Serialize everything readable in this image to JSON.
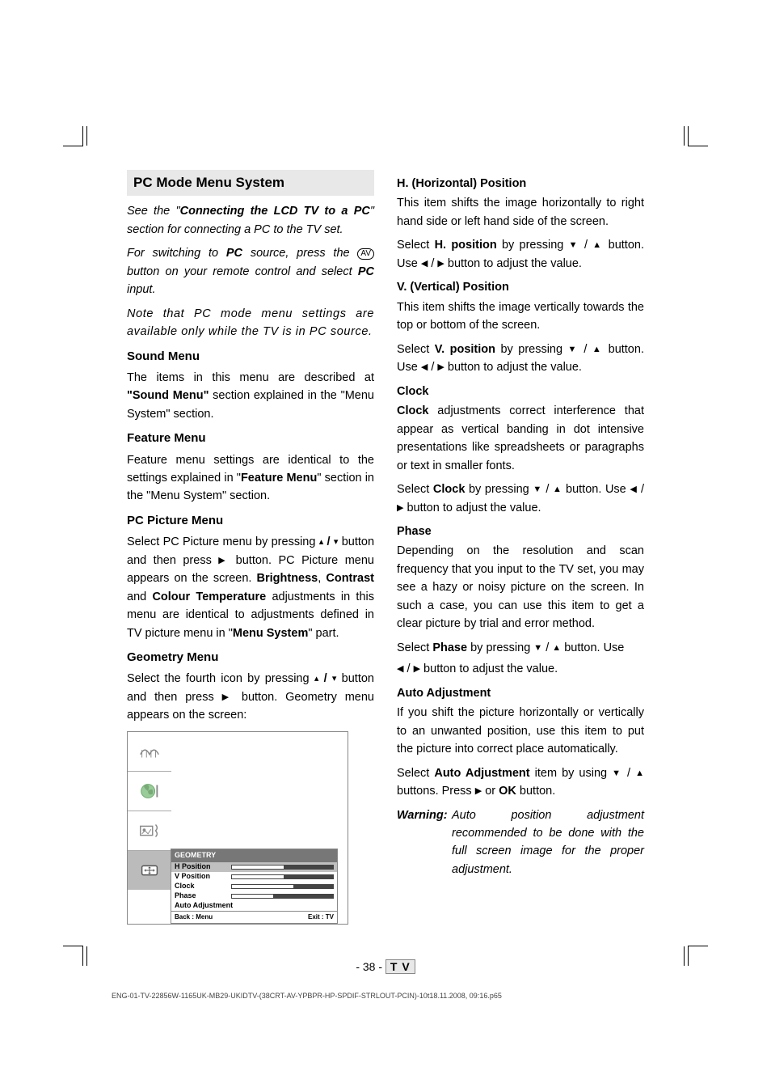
{
  "left": {
    "title": "PC Mode Menu System",
    "intro1_a": "See the \"",
    "intro1_b": "Connecting the LCD TV to a PC",
    "intro1_c": "\" section for connecting a PC to the TV set.",
    "intro2_a": "For switching to ",
    "intro2_b": "PC",
    "intro2_c": " source, press the ",
    "intro2_av": "AV",
    "intro2_d": " button on your remote control and select ",
    "intro2_e": "PC",
    "intro2_f": " input.",
    "intro3": "Note that PC mode menu settings are available only while the TV is in PC source.",
    "sound_h": "Sound Menu",
    "sound_p_a": "The items in this menu are described at ",
    "sound_p_b": "\"Sound Menu\"",
    "sound_p_c": " section explained in the \"Menu System\" section.",
    "feature_h": "Feature Menu",
    "feature_p_a": "Feature menu settings are identical to the settings explained in \"",
    "feature_p_b": "Feature Menu",
    "feature_p_c": "\" section in the \"Menu System\" section.",
    "pcpic_h": "PC Picture Menu",
    "pcpic_a": "Select PC Picture menu by pressing ",
    "pcpic_b": " / ",
    "pcpic_c": " button and then press ",
    "pcpic_d": " button. PC Picture menu appears on the screen. ",
    "pcpic_e": "Brightness",
    "pcpic_f": ", ",
    "pcpic_g": "Contrast",
    "pcpic_h2": " and ",
    "pcpic_i": "Colour Temperature",
    "pcpic_j": " adjustments in this menu are identical to adjustments defined in TV picture menu in \"",
    "pcpic_k": "Menu System",
    "pcpic_l": "\" part.",
    "geom_h": "Geometry Menu",
    "geom_a": "Select the fourth icon by pressing ",
    "geom_b": " / ",
    "geom_c": "  button and then press ",
    "geom_d": " button. Geometry menu appears on the screen:"
  },
  "ui": {
    "title": "GEOMETRY",
    "rows": [
      {
        "label": "H Position",
        "fill": 50
      },
      {
        "label": "V Position",
        "fill": 50
      },
      {
        "label": "Clock",
        "fill": 60
      },
      {
        "label": "Phase",
        "fill": 40
      },
      {
        "label": "Auto Adjustment",
        "fill": null
      }
    ],
    "foot_left": "Back : Menu",
    "foot_right": "Exit : TV"
  },
  "right": {
    "hpos_h": "H. (Horizontal) Position",
    "hpos_p": "This item shifts the image horizontally to right hand side or left hand side of the screen.",
    "hpos_sel_a": "Select ",
    "hpos_sel_b": "H. position",
    "hpos_sel_c": " by pressing ",
    "hpos_sel_d": " button. Use ",
    "hpos_sel_e": " button to adjust the value.",
    "vpos_h": "V. (Vertical) Position",
    "vpos_p": "This item shifts the image vertically towards the top or bottom of the screen.",
    "vpos_sel_a": "Select ",
    "vpos_sel_b": "V. position",
    "vpos_sel_c": " by pressing ",
    "vpos_sel_d": " button. Use ",
    "vpos_sel_e": " button to adjust the value.",
    "clock_h": "Clock",
    "clock_p_a": "Clock",
    "clock_p_b": " adjustments correct interference that appear as vertical banding in dot intensive presentations like spreadsheets or paragraphs or text in smaller fonts.",
    "clock_sel_a": "Select ",
    "clock_sel_b": "Clock",
    "clock_sel_c": " by pressing ",
    "clock_sel_d": " button. Use ",
    "clock_sel_e": " button to adjust the value.",
    "phase_h": "Phase",
    "phase_p": "Depending on the resolution and scan frequency that you input to the TV set, you may see a hazy or noisy picture on the screen. In such a case, you can use this item to get a clear picture by trial and error method.",
    "phase_sel_a": "Select ",
    "phase_sel_b": "Phase",
    "phase_sel_c": " by pressing ",
    "phase_sel_d": " button. Use",
    "phase_sel_e": " button to adjust the value.",
    "auto_h": "Auto Adjustment",
    "auto_p": "If you shift the picture horizontally or vertically to an unwanted position, use this item to put the picture into correct place automatically.",
    "auto_sel_a": "Select ",
    "auto_sel_b": "Auto Adjustment",
    "auto_sel_c": " item by using ",
    "auto_sel_d": " buttons. Press ",
    "auto_sel_e": " or ",
    "auto_sel_f": "OK",
    "auto_sel_g": " button.",
    "warn_label": "Warning:",
    "warn_text": "Auto position adjustment recommended to be done with the full screen image for the proper adjustment."
  },
  "footer": {
    "page_a": "- 38 -",
    "tv": "T V",
    "file": "ENG-01-TV-22856W-1165UK-MB29-UKIDTV-(38CRT-AV-YPBPR-HP-SPDIF-STRLOUT-PCIN)-10t18.11.2008, 09:16.p65"
  },
  "glyphs": {
    "up": "▲",
    "down": "▼",
    "left": "◀",
    "right": "▶",
    "upS": "▴",
    "downS": "▾",
    "slash": " / "
  }
}
